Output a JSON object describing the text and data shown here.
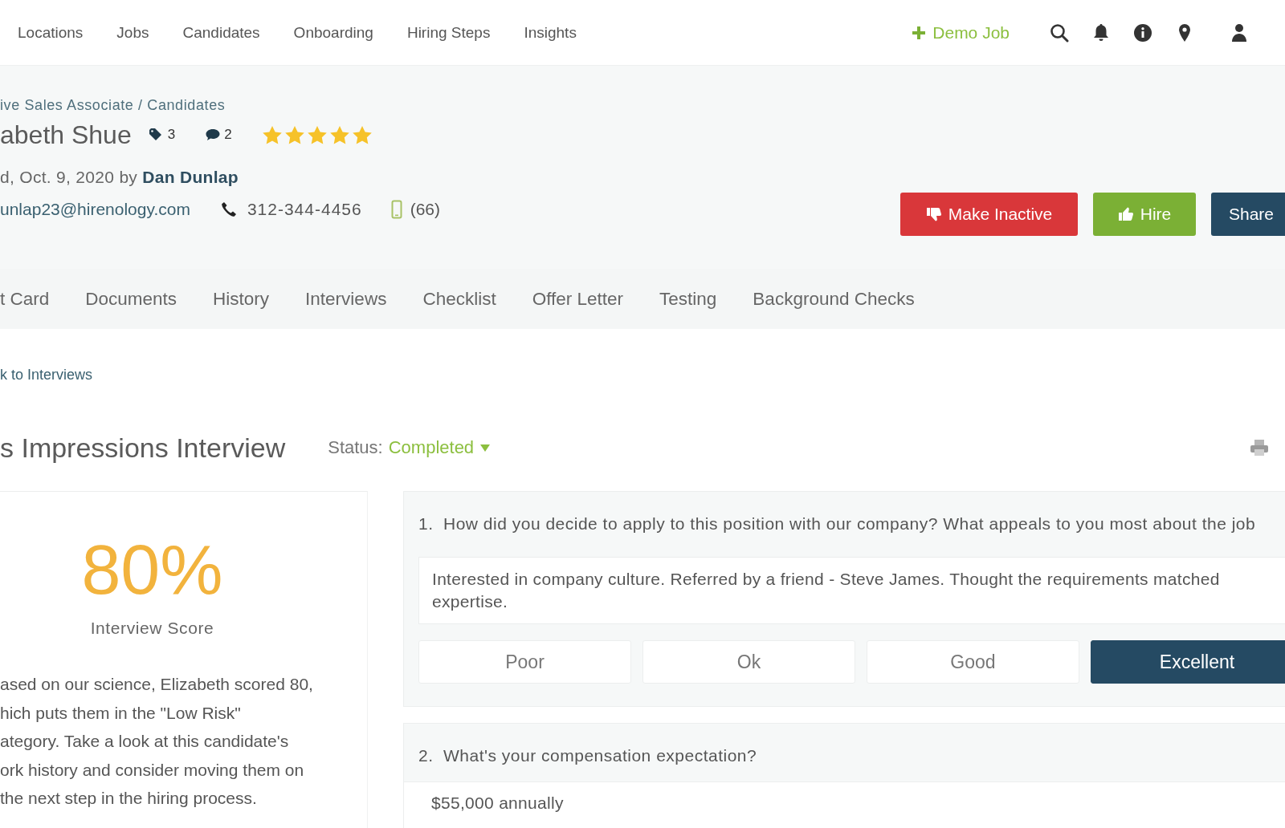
{
  "nav": {
    "items": [
      "Locations",
      "Jobs",
      "Candidates",
      "Onboarding",
      "Hiring Steps",
      "Insights"
    ],
    "demo_job": "Demo Job"
  },
  "candidate": {
    "breadcrumb": "ive Sales Associate / Candidates",
    "name": "abeth Shue",
    "tags_count": "3",
    "comments_count": "2",
    "stars": 5,
    "added": "d, Oct. 9, 2020 by ",
    "added_by": "Dan Dunlap",
    "email": "unlap23@hirenology.com",
    "phone": "312-344-4456",
    "mobile": "(66)"
  },
  "actions": [
    {
      "label": "Make Inactive",
      "kind": "inactive"
    },
    {
      "label": "Hire",
      "kind": "hire"
    },
    {
      "label": "Share",
      "kind": "share"
    }
  ],
  "tabs": [
    "t Card",
    "Documents",
    "History",
    "Interviews",
    "Checklist",
    "Offer Letter",
    "Testing",
    "Background Checks"
  ],
  "back_link": "k to Interviews",
  "interview": {
    "title": "s Impressions Interview",
    "status_label": "Status:",
    "status": "Completed"
  },
  "score": {
    "value": "80%",
    "label": "Interview Score",
    "summary": "ased on our science, Elizabeth scored 80,\nhich puts them in the \"Low Risk\"\nategory. Take a look at this candidate's\nork history and consider moving them on\nthe next step in the hiring process."
  },
  "questions": [
    {
      "number": "1.",
      "text": "How did you decide to apply to this position with our company? What appeals to you most about the job",
      "answer": "Interested in company culture. Referred by a friend - Steve James. Thought the requirements matched expertise.",
      "ratings": [
        {
          "label": "Poor",
          "selected": false
        },
        {
          "label": "Ok",
          "selected": false
        },
        {
          "label": "Good",
          "selected": false
        },
        {
          "label": "Excellent",
          "selected": true
        }
      ]
    },
    {
      "number": "2.",
      "text": "What's your compensation expectation?",
      "answer": "$55,000 annually"
    }
  ]
}
